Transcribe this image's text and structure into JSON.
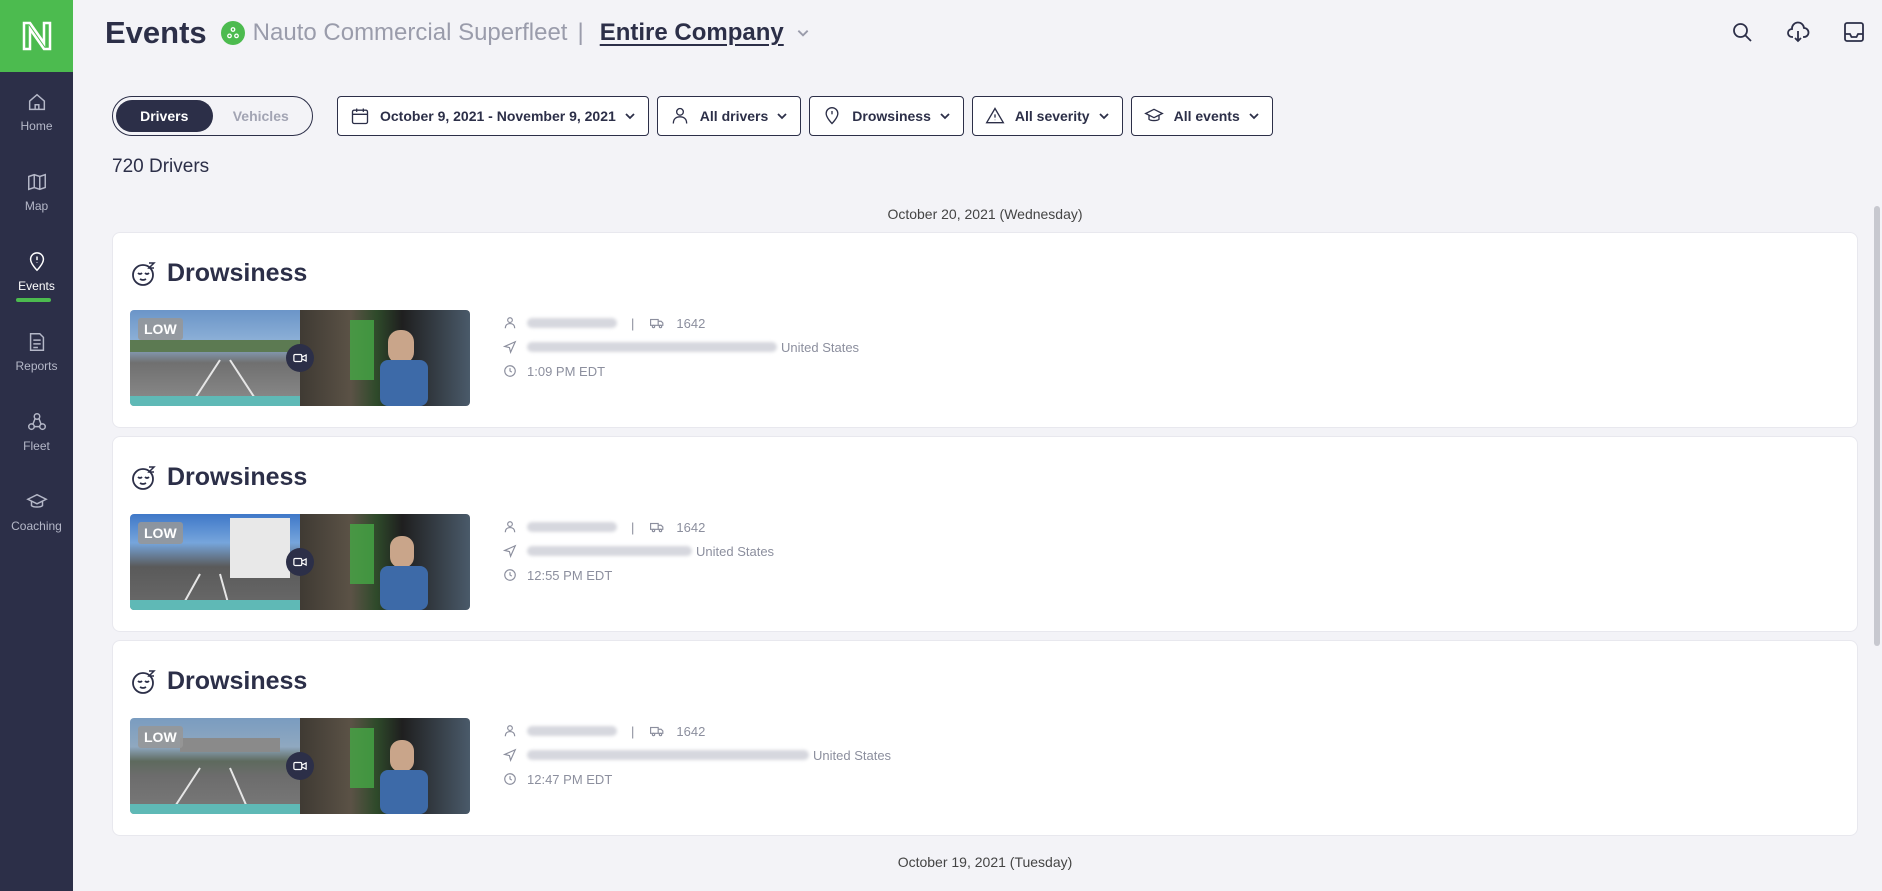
{
  "sidebar": {
    "items": [
      {
        "label": "Home",
        "icon": "home-icon"
      },
      {
        "label": "Map",
        "icon": "map-icon"
      },
      {
        "label": "Events",
        "icon": "pin-icon"
      },
      {
        "label": "Reports",
        "icon": "document-icon"
      },
      {
        "label": "Fleet",
        "icon": "fleet-icon"
      },
      {
        "label": "Coaching",
        "icon": "graduation-cap-icon"
      }
    ],
    "active": "Events"
  },
  "header": {
    "title": "Events",
    "org_name": "Nauto Commercial Superfleet",
    "separator": "|",
    "scope": "Entire Company"
  },
  "filters": {
    "toggle": {
      "drivers": "Drivers",
      "vehicles": "Vehicles",
      "selected": "Drivers"
    },
    "date_range": "October 9, 2021 - November 9, 2021",
    "drivers": "All drivers",
    "event_type": "Drowsiness",
    "severity": "All severity",
    "coaching": "All events"
  },
  "count_label": "720 Drivers",
  "groups": [
    {
      "date": "October 20, 2021 (Wednesday)",
      "events": [
        {
          "type": "Drowsiness",
          "severity": "LOW",
          "vehicle": "1642",
          "location_suffix": "United States",
          "time": "1:09 PM EDT"
        },
        {
          "type": "Drowsiness",
          "severity": "LOW",
          "vehicle": "1642",
          "location_suffix": "United States",
          "time": "12:55 PM EDT"
        },
        {
          "type": "Drowsiness",
          "severity": "LOW",
          "vehicle": "1642",
          "location_suffix": "United States",
          "time": "12:47 PM EDT"
        }
      ]
    },
    {
      "date": "October 19, 2021 (Tuesday)",
      "events": []
    }
  ],
  "colors": {
    "sidebar_bg": "#2c2f48",
    "brand_green": "#4cbb4f",
    "page_bg": "#f3f3f7"
  }
}
